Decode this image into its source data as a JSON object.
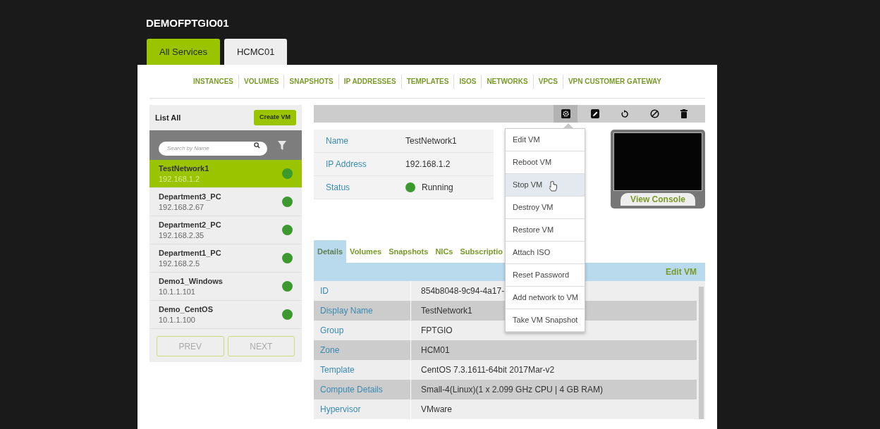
{
  "header": {
    "title": "DEMOFPTGIO01"
  },
  "service_tabs": [
    {
      "label": "All Services",
      "selected": true
    },
    {
      "label": "HCMC01",
      "selected": false
    }
  ],
  "nav": [
    "INSTANCES",
    "VOLUMES",
    "SNAPSHOTS",
    "IP ADDRESSES",
    "TEMPLATES",
    "ISOS",
    "NETWORKS",
    "VPCS",
    "VPN CUSTOMER GATEWAY"
  ],
  "sidebar": {
    "title": "List All",
    "create_button": "Create VM",
    "search": {
      "placeholder": "Search by Name"
    },
    "items": [
      {
        "name": "TestNetwork1",
        "ip": "192.168.1.2",
        "selected": true,
        "color": "#3a9a2e"
      },
      {
        "name": "Department3_PC",
        "ip": "192.168.2.67",
        "selected": false,
        "color": "#3a9a2e"
      },
      {
        "name": "Department2_PC",
        "ip": "192.168.2.35",
        "selected": false,
        "color": "#3a9a2e"
      },
      {
        "name": "Department1_PC",
        "ip": "192.168.2.5",
        "selected": false,
        "color": "#3a9a2e"
      },
      {
        "name": "Demo1_Windows",
        "ip": "10.1.1.101",
        "selected": false,
        "color": "#3a9a2e"
      },
      {
        "name": "Demo_CentOS",
        "ip": "10.1.1.100",
        "selected": false,
        "color": "#3a9a2e"
      }
    ],
    "pager": [
      "PREV",
      "NEXT"
    ]
  },
  "toolbar": [
    {
      "kind": "settings",
      "selected": true
    },
    {
      "kind": "edit",
      "selected": false
    },
    {
      "kind": "reboot",
      "selected": false
    },
    {
      "kind": "stop",
      "selected": false
    },
    {
      "kind": "delete",
      "selected": false
    }
  ],
  "summary": [
    {
      "label": "Name",
      "value": "TestNetwork1"
    },
    {
      "label": "IP Address",
      "value": "192.168.1.2"
    },
    {
      "label": "Status",
      "value": "Running",
      "color": "#3a9a2e"
    }
  ],
  "console": {
    "label": "View Console"
  },
  "action_menu": [
    {
      "label": "Edit VM",
      "highlighted": false
    },
    {
      "label": "Reboot VM",
      "highlighted": false
    },
    {
      "label": "Stop VM",
      "highlighted": true
    },
    {
      "label": "Destroy VM",
      "highlighted": false
    },
    {
      "label": "Restore VM",
      "highlighted": false
    },
    {
      "label": "Attach ISO",
      "highlighted": false
    },
    {
      "label": "Reset Password",
      "highlighted": false
    },
    {
      "label": "Add network to VM",
      "highlighted": false
    },
    {
      "label": "Take VM Snapshot",
      "highlighted": false
    }
  ],
  "detail_tabs": [
    {
      "label": "Details",
      "selected": true
    },
    {
      "label": "Volumes",
      "selected": false
    },
    {
      "label": "Snapshots",
      "selected": false
    },
    {
      "label": "NICs",
      "selected": false
    },
    {
      "label": "Subscriptio",
      "selected": false
    }
  ],
  "edit_link": "Edit VM",
  "details": [
    {
      "label": "ID",
      "value": "854b8048-9c94-4a17-"
    },
    {
      "label": "Display Name",
      "value": "TestNetwork1"
    },
    {
      "label": "Group",
      "value": "FPTGIO"
    },
    {
      "label": "Zone",
      "value": "HCM01"
    },
    {
      "label": "Template",
      "value": "CentOS 7.3.1611-64bit 2017Mar-v2"
    },
    {
      "label": "Compute Details",
      "value": "Small-4(Linux)(1 x 2.099 GHz CPU | 4 GB RAM)"
    },
    {
      "label": "Hypervisor",
      "value": "VMware"
    }
  ]
}
